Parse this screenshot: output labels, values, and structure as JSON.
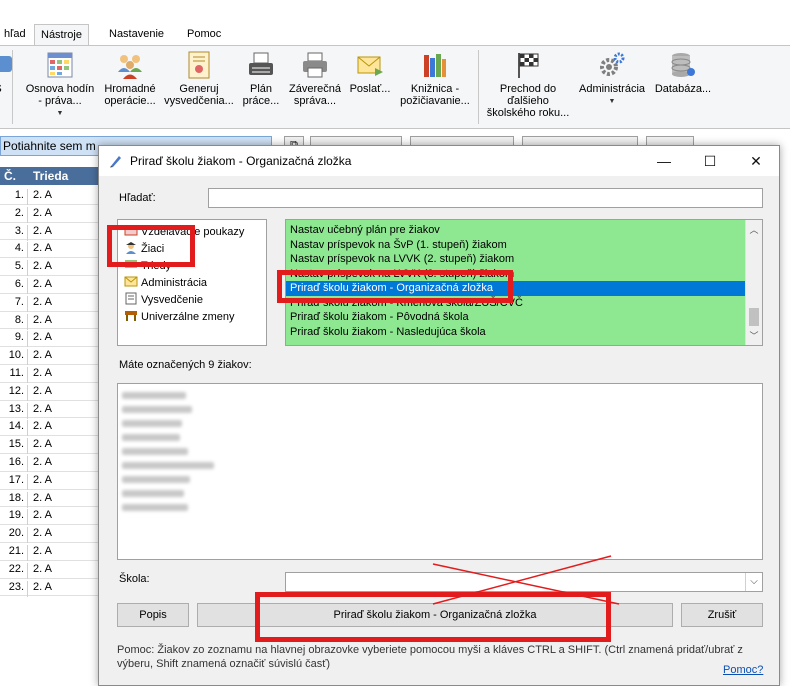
{
  "ribbon": {
    "tabs": [
      {
        "label": "hľad"
      },
      {
        "label": "Nástroje"
      },
      {
        "label": "Nastavenie"
      },
      {
        "label": "Pomoc"
      }
    ],
    "buttons": [
      {
        "line1": "Osnova hodín",
        "line2": "- práva..."
      },
      {
        "line1": "Hromadné",
        "line2": "operácie..."
      },
      {
        "line1": "Generuj",
        "line2": "vysvedčenia..."
      },
      {
        "line1": "Plán",
        "line2": "práce..."
      },
      {
        "line1": "Záverečná",
        "line2": "správa..."
      },
      {
        "line1": "Poslať..."
      },
      {
        "line1": "Knižnica -",
        "line2": "požičiavanie..."
      },
      {
        "line1": "Prechod do",
        "line2": "ďalšieho",
        "line3": "školského roku..."
      },
      {
        "line1": "Administrácia"
      },
      {
        "line1": "Databáza..."
      }
    ]
  },
  "background": {
    "group_bar_text": "Potiahnite sem m",
    "grid_headers": {
      "num": "Č.",
      "class": "Trieda"
    },
    "grid_rows": [
      {
        "n": "1.",
        "t": "2. A"
      },
      {
        "n": "2.",
        "t": "2. A"
      },
      {
        "n": "3.",
        "t": "2. A"
      },
      {
        "n": "4.",
        "t": "2. A"
      },
      {
        "n": "5.",
        "t": "2. A"
      },
      {
        "n": "6.",
        "t": "2. A"
      },
      {
        "n": "7.",
        "t": "2. A"
      },
      {
        "n": "8.",
        "t": "2. A"
      },
      {
        "n": "9.",
        "t": "2. A"
      },
      {
        "n": "10.",
        "t": "2. A"
      },
      {
        "n": "11.",
        "t": "2. A"
      },
      {
        "n": "12.",
        "t": "2. A"
      },
      {
        "n": "13.",
        "t": "2. A"
      },
      {
        "n": "14.",
        "t": "2. A"
      },
      {
        "n": "15.",
        "t": "2. A"
      },
      {
        "n": "16.",
        "t": "2. A"
      },
      {
        "n": "17.",
        "t": "2. A"
      },
      {
        "n": "18.",
        "t": "2. A"
      },
      {
        "n": "19.",
        "t": "2. A"
      },
      {
        "n": "20.",
        "t": "2. A"
      },
      {
        "n": "21.",
        "t": "2. A"
      },
      {
        "n": "22.",
        "t": "2. A"
      },
      {
        "n": "23.",
        "t": "2. A"
      }
    ]
  },
  "dialog": {
    "title": "Priraď školu žiakom - Organizačná zložka",
    "search_label": "Hľadať:",
    "search_value": "",
    "categories": [
      {
        "label": "Vzdelávacie poukazy"
      },
      {
        "label": "Žiaci"
      },
      {
        "label": "Triedy"
      },
      {
        "label": "Administrácia"
      },
      {
        "label": "Vysvedčenie"
      },
      {
        "label": "Univerzálne zmeny"
      }
    ],
    "actions": [
      {
        "label": "Nastav učebný plán pre žiakov"
      },
      {
        "label": "Nastav príspevok na ŠvP (1. stupeň) žiakom"
      },
      {
        "label": "Nastav príspevok na LVVK (2. stupeň) žiakom"
      },
      {
        "label": "Nastav príspevok na LVVK (3. stupeň) žiakom"
      },
      {
        "label": "Priraď školu žiakom - Organizačná zložka"
      },
      {
        "label": "Priraď školu žiakom - Kmeňová škola/ZUŠ/CVČ"
      },
      {
        "label": "Priraď školu žiakom - Pôvodná škola"
      },
      {
        "label": "Priraď školu žiakom - Nasledujúca škola"
      }
    ],
    "selected_action_index": 4,
    "marked_label": "Máte označených 9 žiakov:",
    "school_label": "Škola:",
    "school_value": "",
    "btn_popis": "Popis",
    "btn_apply": "Priraď školu žiakom - Organizačná zložka",
    "btn_cancel": "Zrušiť",
    "help_text": "Pomoc: Žiakov zo zoznamu na hlavnej obrazovke vyberiete pomocou myši a kláves CTRL a SHIFT. (Ctrl znamená pridať/ubrať z výberu, Shift znamená označiť súvislú časť)",
    "help_link": "Pomoc?"
  },
  "colors": {
    "actions_bg": "#8ee891",
    "selection": "#0078d7",
    "highlight": "#e21c1c"
  }
}
